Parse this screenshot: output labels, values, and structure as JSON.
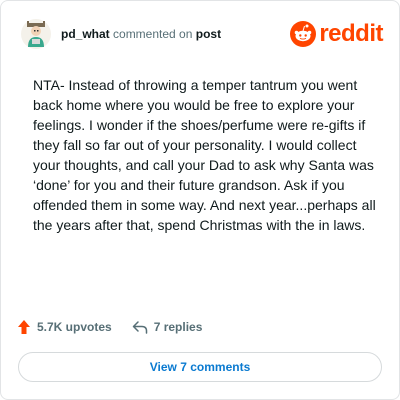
{
  "header": {
    "username": "pd_what",
    "action_text": "commented on",
    "target_text": "post"
  },
  "logo": {
    "text": "reddit",
    "color": "#ff4500"
  },
  "comment": {
    "text": "NTA- Instead of throwing a temper tantrum you went back home where you would be free to explore your feelings. I wonder if the shoes/perfume were re-gifts if they fall so far out of your personality. I would collect your thoughts, and call your Dad to ask why Santa was ‘done’ for you and their future grandson. Ask if you offended them in some way. And next year...perhaps all the years after that, spend Christmas with the in laws."
  },
  "actions": {
    "upvotes_label": "5.7K upvotes",
    "replies_label": "7 replies",
    "upvote_icon": "upvote-arrow-icon",
    "reply_icon": "reply-arrow-icon"
  },
  "view_comments_label": "View 7 comments",
  "colors": {
    "accent": "#ff4500",
    "link": "#0a7ad0",
    "text": "#0f1a1c",
    "muted": "#576f76"
  }
}
